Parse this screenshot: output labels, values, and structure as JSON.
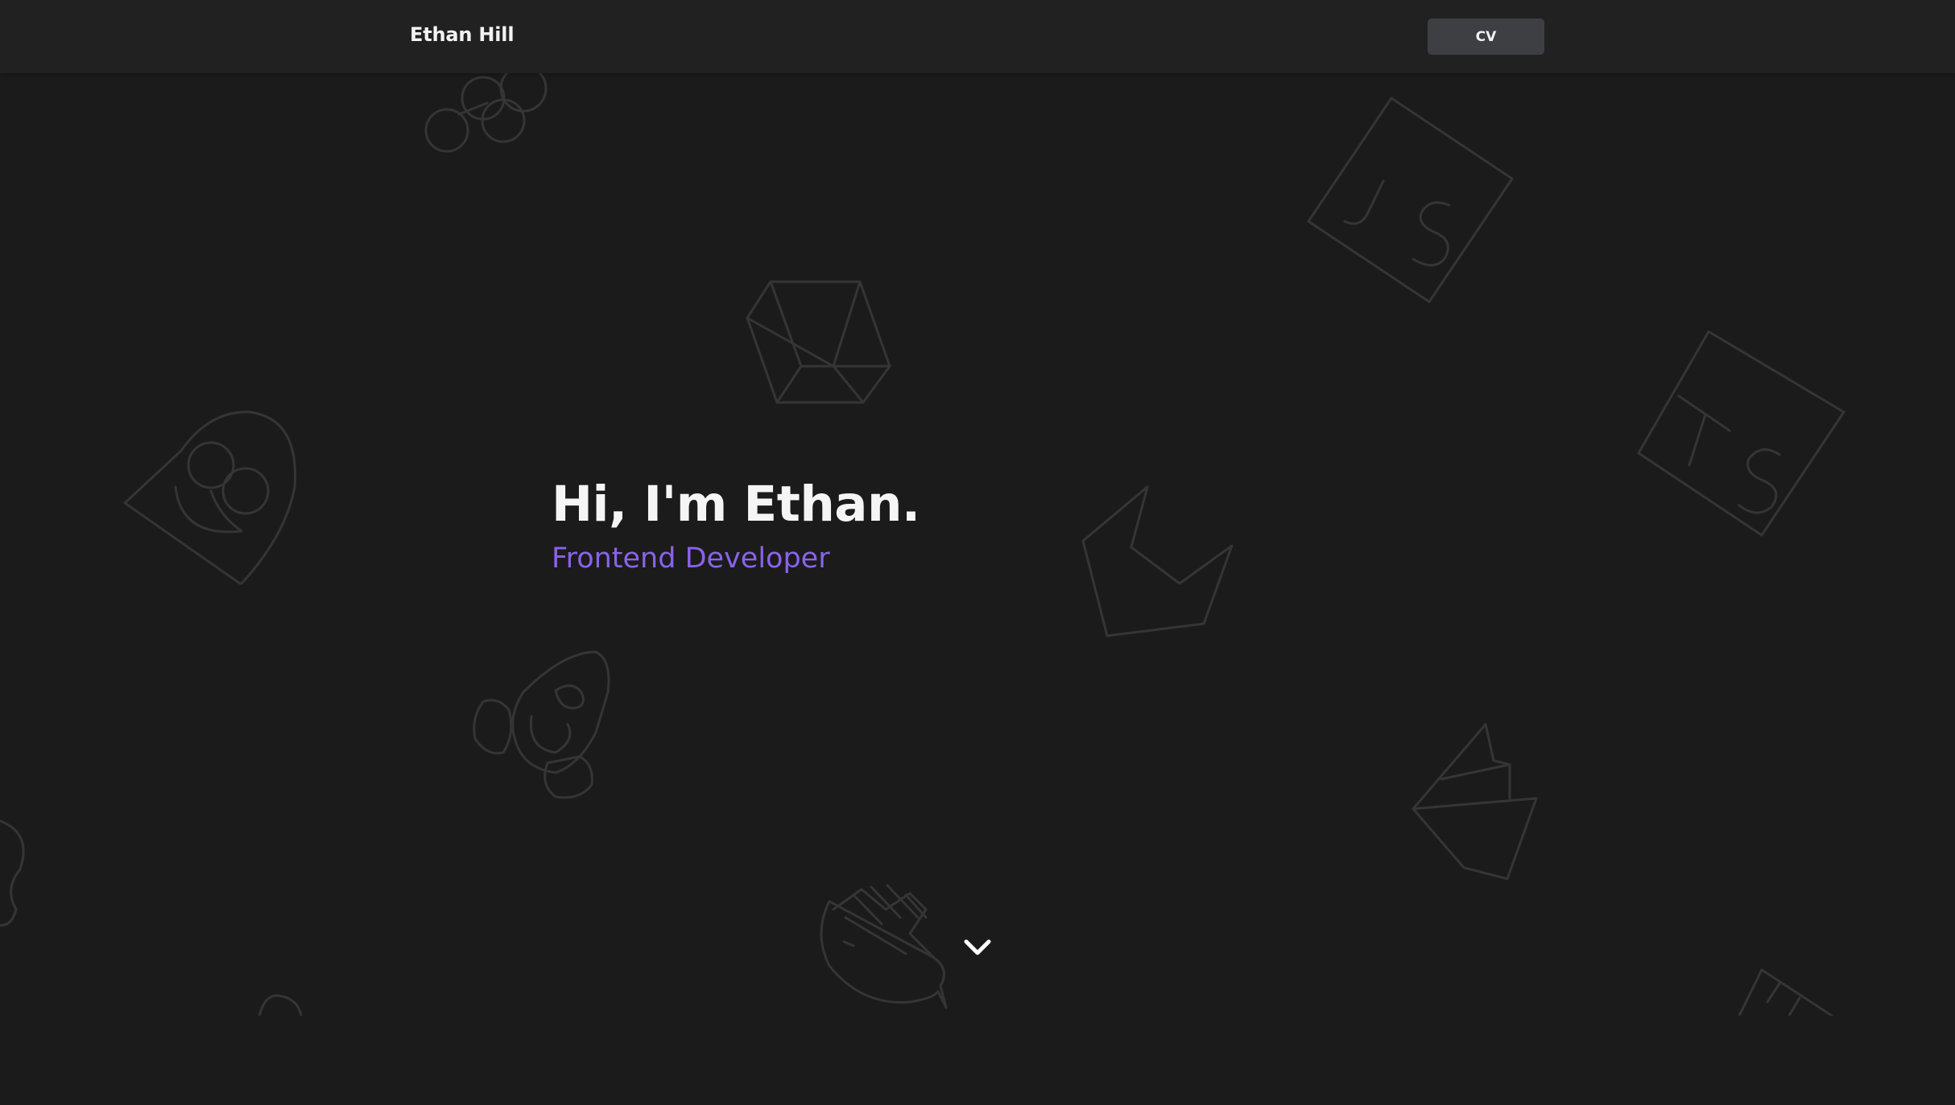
{
  "navbar": {
    "brand": "Ethan Hill",
    "cv_label": "CV"
  },
  "hero": {
    "title": "Hi, I'm Ethan.",
    "subtitle": "Frontend Developer"
  },
  "background_icons": [
    "flutter-icon",
    "cube-icon",
    "javascript-icon",
    "typescript-icon",
    "react-native-icon",
    "gitlab-icon",
    "linux-icon",
    "docker-icon",
    "sailboat-icon"
  ],
  "scroll": {
    "icon": "chevron-down-icon"
  },
  "colors": {
    "background": "#1b1b1b",
    "navbar": "#212121",
    "accent": "#8a63e8",
    "button": "#3d3f43",
    "icon_stroke": "#353535"
  }
}
